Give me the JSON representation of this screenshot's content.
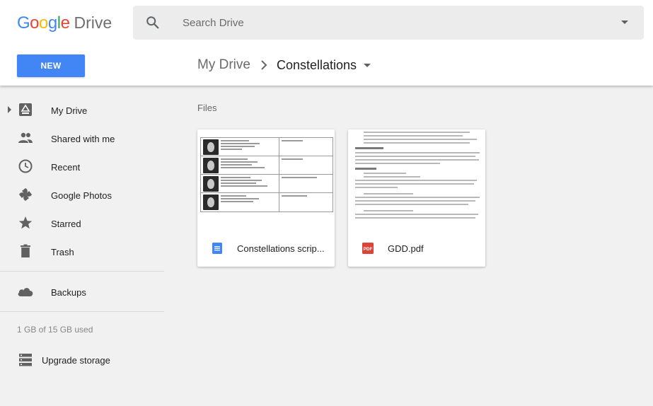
{
  "app": {
    "logo_google": "Google",
    "logo_product": "Drive",
    "brand_colors": {
      "blue": "#4285f4",
      "red": "#ea4335",
      "yellow": "#fbbc05",
      "green": "#34a853"
    }
  },
  "search": {
    "placeholder": "Search Drive"
  },
  "toolbar": {
    "new_label": "NEW"
  },
  "breadcrumb": {
    "root": "My Drive",
    "current": "Constellations"
  },
  "sidebar": {
    "items": [
      {
        "label": "My Drive",
        "icon": "my-drive-icon"
      },
      {
        "label": "Shared with me",
        "icon": "people-icon"
      },
      {
        "label": "Recent",
        "icon": "clock-icon"
      },
      {
        "label": "Google Photos",
        "icon": "pinwheel-icon"
      },
      {
        "label": "Starred",
        "icon": "star-icon"
      },
      {
        "label": "Trash",
        "icon": "trash-icon"
      }
    ],
    "backups": {
      "label": "Backups",
      "icon": "cloud-icon"
    },
    "quota": "1 GB of 15 GB used",
    "upgrade": {
      "label": "Upgrade storage",
      "icon": "storage-icon"
    }
  },
  "main": {
    "section_label": "Files",
    "files": [
      {
        "name": "Constellations scrip...",
        "type": "google-doc",
        "icon": "google-docs-icon",
        "color": "#4285f4"
      },
      {
        "name": "GDD.pdf",
        "type": "pdf",
        "icon": "pdf-icon",
        "color": "#db4437"
      }
    ]
  }
}
